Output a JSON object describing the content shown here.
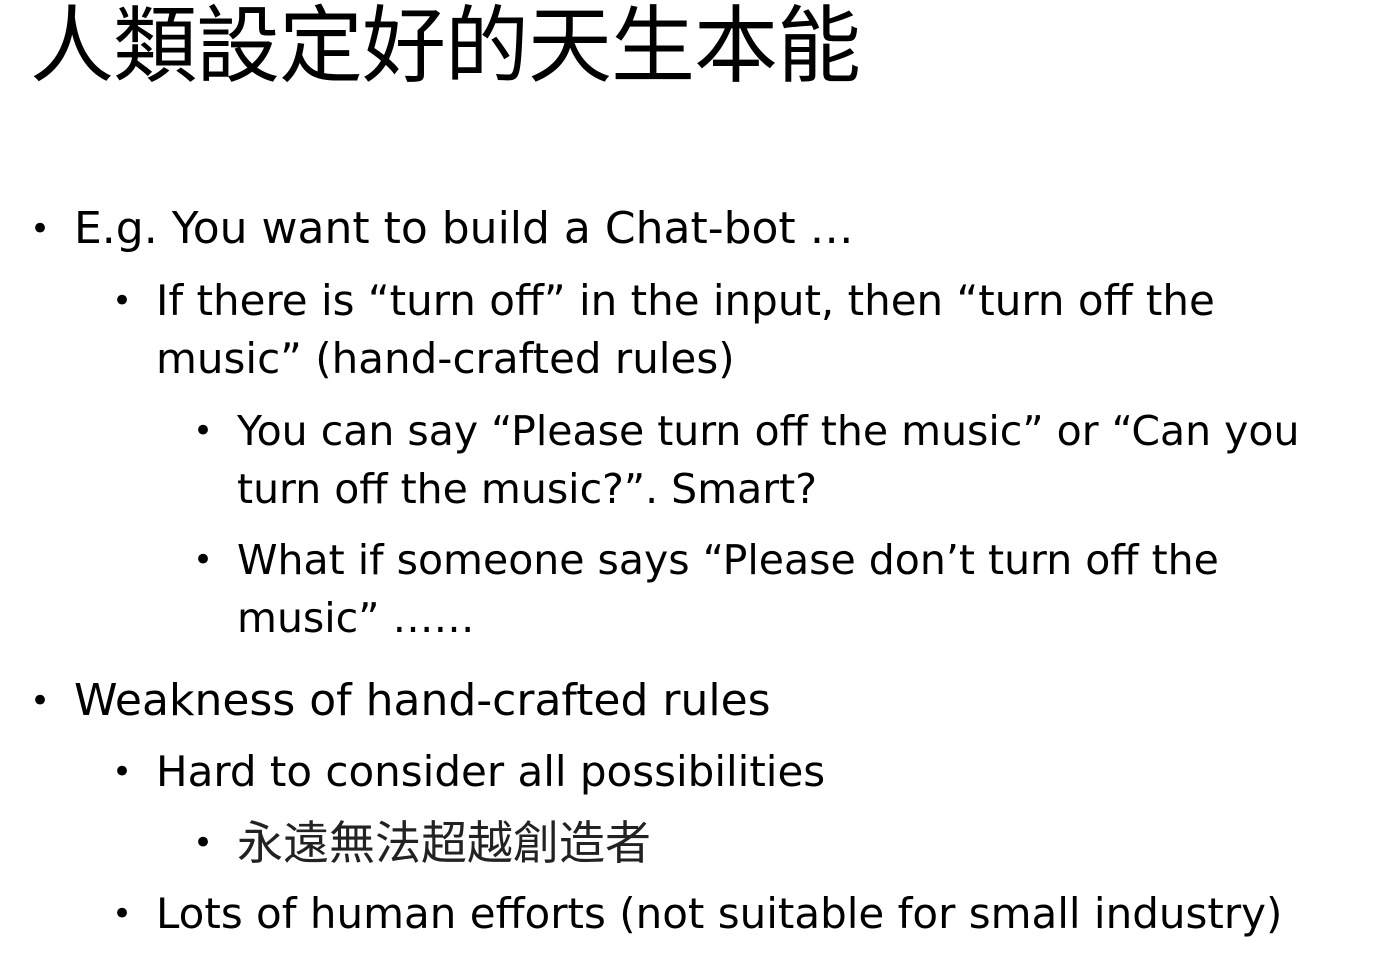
{
  "slide": {
    "title": "人類設定好的天生本能",
    "bullet_symbol": "•",
    "items": [
      {
        "level": 1,
        "lines": [
          "E.g. You want to build a Chat-bot …"
        ]
      },
      {
        "level": 2,
        "lines": [
          "If there is “turn off” in the input, then “turn off the",
          "music” (hand-crafted rules)"
        ]
      },
      {
        "level": 3,
        "lines": [
          "You can say “Please turn off the music” or “Can you",
          "turn off the music?”. Smart?"
        ]
      },
      {
        "level": 3,
        "lines": [
          "What if someone says “Please don’t turn off the",
          "music” ……"
        ]
      },
      {
        "level": 1,
        "lines": [
          "Weakness of hand-crafted rules"
        ]
      },
      {
        "level": 2,
        "lines": [
          "Hard to consider all possibilities"
        ]
      },
      {
        "level": 3,
        "lines": [
          "永遠無法超越創造者"
        ]
      },
      {
        "level": 2,
        "lines": [
          "Lots of human efforts (not suitable for small industry)"
        ]
      }
    ]
  }
}
